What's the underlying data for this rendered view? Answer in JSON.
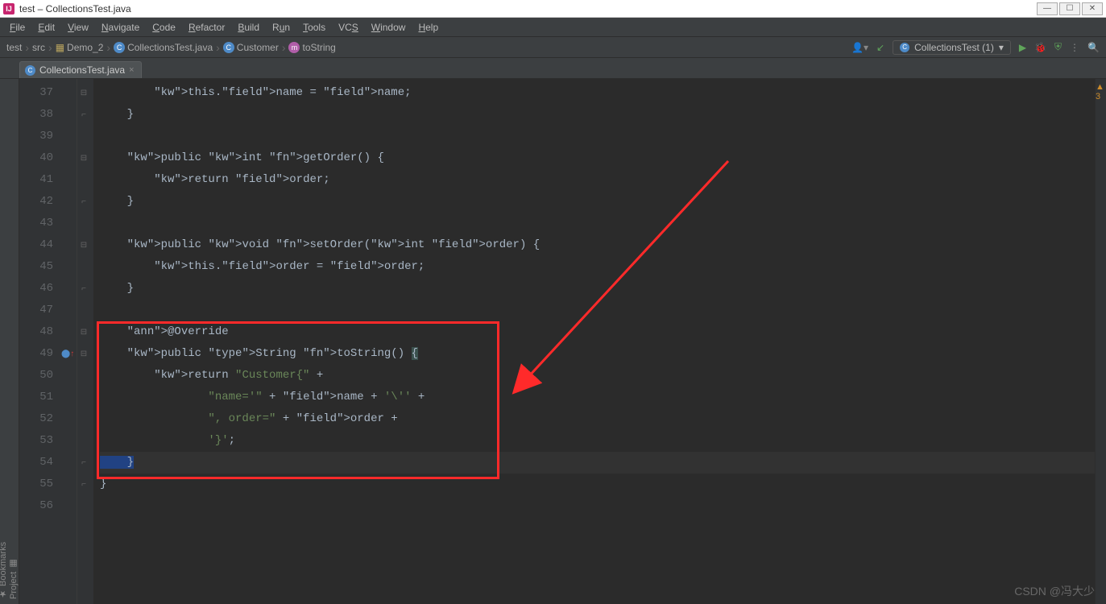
{
  "window": {
    "title": "test – CollectionsTest.java"
  },
  "menu": [
    "File",
    "Edit",
    "View",
    "Navigate",
    "Code",
    "Refactor",
    "Build",
    "Run",
    "Tools",
    "VCS",
    "Window",
    "Help"
  ],
  "breadcrumbs": [
    {
      "label": "test",
      "icon": "folder"
    },
    {
      "label": "src",
      "icon": "folder"
    },
    {
      "label": "Demo_2",
      "icon": "folder"
    },
    {
      "label": "CollectionsTest.java",
      "icon": "class"
    },
    {
      "label": "Customer",
      "icon": "class"
    },
    {
      "label": "toString",
      "icon": "method"
    }
  ],
  "runConfig": {
    "label": "CollectionsTest (1)",
    "chev": "▾"
  },
  "tab": {
    "label": "CollectionsTest.java"
  },
  "sidebar": {
    "project": "Project",
    "bookmarks": "Bookmarks"
  },
  "warnings": {
    "count": "3",
    "glyph": "▲"
  },
  "code": {
    "startLine": 37,
    "lines": [
      "        this.name = name;",
      "    }",
      "",
      "    public int getOrder() {",
      "        return order;",
      "    }",
      "",
      "    public void setOrder(int order) {",
      "        this.order = order;",
      "    }",
      "",
      "    @Override",
      "    public String toString() {",
      "        return \"Customer{\" +",
      "                \"name='\" + name + '\\'' +",
      "                \", order=\" + order +",
      "                '}';",
      "    }",
      "}",
      ""
    ]
  },
  "watermark": "CSDN @冯大少",
  "winbtns": {
    "min": "—",
    "max": "☐",
    "close": "✕"
  }
}
